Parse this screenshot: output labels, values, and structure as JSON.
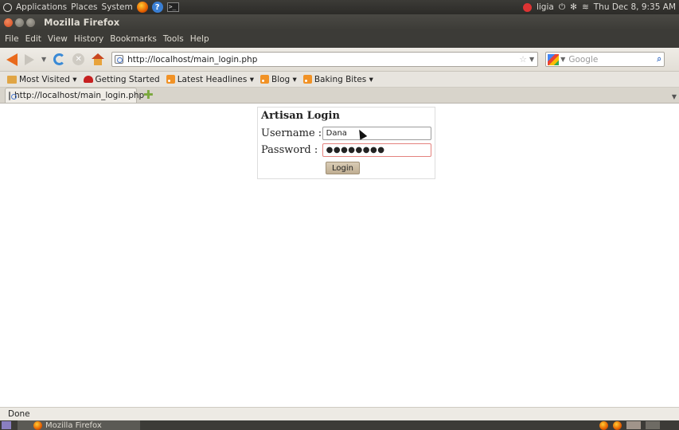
{
  "top_panel": {
    "menus": [
      "Applications",
      "Places",
      "System"
    ],
    "user": "ligia",
    "clock": "Thu Dec  8,  9:35 AM"
  },
  "window": {
    "title": "Mozilla Firefox"
  },
  "menubar": [
    "File",
    "Edit",
    "View",
    "History",
    "Bookmarks",
    "Tools",
    "Help"
  ],
  "navbar": {
    "url": "http://localhost/main_login.php",
    "search_placeholder": "Google"
  },
  "bookmarks": [
    {
      "label": "Most Visited ▾",
      "icon": "folder-icon"
    },
    {
      "label": "Getting Started",
      "icon": "red-hat-icon"
    },
    {
      "label": "Latest Headlines ▾",
      "icon": "rss-icon"
    },
    {
      "label": "Blog ▾",
      "icon": "rss-icon"
    },
    {
      "label": "Baking Bites ▾",
      "icon": "rss-icon"
    }
  ],
  "tab": {
    "label": "http://localhost/main_login.php"
  },
  "login": {
    "title": "Artisan Login",
    "username_label": "Username :",
    "username_value": "Dana",
    "password_label": "Password  :",
    "password_dots": "●●●●●●●●",
    "button_label": "Login"
  },
  "status": "Done",
  "taskbar": {
    "task_label": "Mozilla Firefox"
  }
}
